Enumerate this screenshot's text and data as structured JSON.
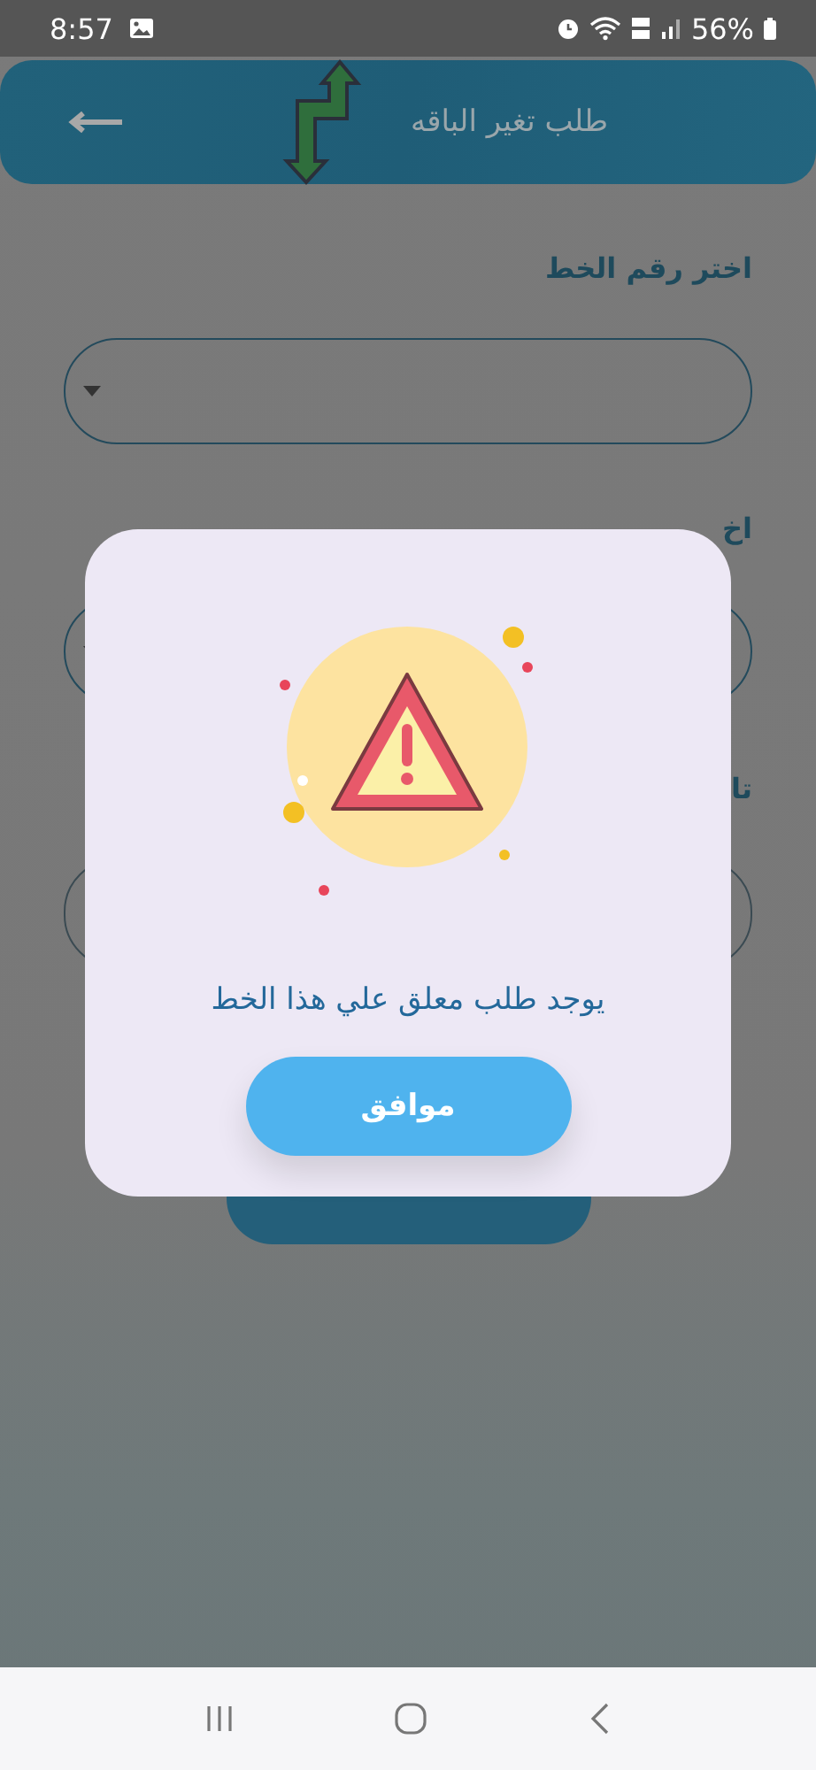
{
  "status_bar": {
    "time": "8:57",
    "battery": "56%"
  },
  "header": {
    "title": "طلب تغير الباقه"
  },
  "form": {
    "fields": [
      {
        "label": "اختر رقم الخط",
        "kind": "dropdown"
      },
      {
        "label": "اخ",
        "kind": "dropdown"
      },
      {
        "label": "تا",
        "kind": "input"
      }
    ]
  },
  "dialog": {
    "message": "يوجد طلب معلق علي هذا الخط",
    "button": "موافق"
  }
}
